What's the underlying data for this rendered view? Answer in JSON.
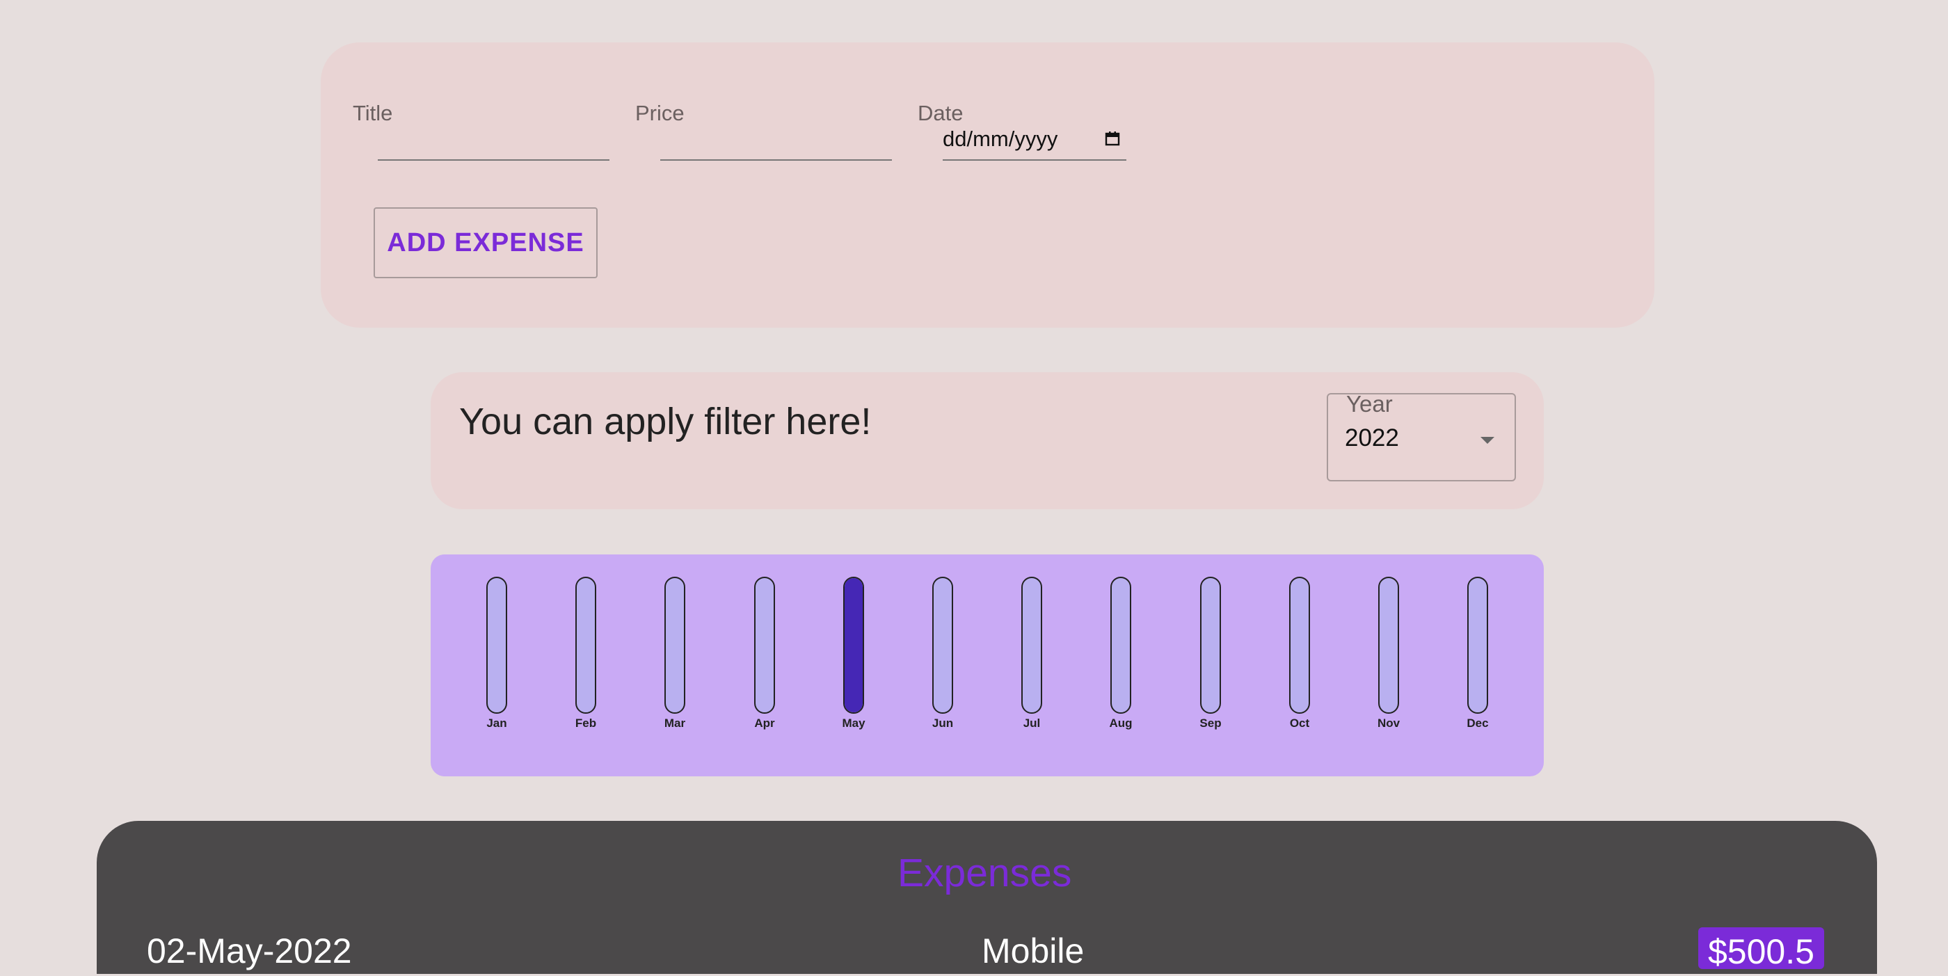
{
  "form": {
    "title_label": "Title",
    "title_value": "",
    "price_label": "Price",
    "price_value": "",
    "date_label": "Date",
    "date_placeholder": "dd/mm/yyyy",
    "add_button_label": "ADD EXPENSE"
  },
  "filter": {
    "heading": "You can apply filter here!",
    "year_label": "Year",
    "year_value": "2022"
  },
  "chart_data": {
    "type": "bar",
    "categories": [
      "Jan",
      "Feb",
      "Mar",
      "Apr",
      "May",
      "Jun",
      "Jul",
      "Aug",
      "Sep",
      "Oct",
      "Nov",
      "Dec"
    ],
    "values": [
      0,
      0,
      0,
      0,
      1,
      0,
      0,
      0,
      0,
      0,
      0,
      0
    ],
    "ylim": [
      0,
      1
    ],
    "fill_color": "#4527b5",
    "track_color": "#b9b0f0"
  },
  "expenses": {
    "title": "Expenses",
    "items": [
      {
        "date": "02-May-2022",
        "title": "Mobile",
        "price": "$500.5"
      }
    ]
  },
  "colors": {
    "background": "#e6dedd",
    "card": "#e9d4d4",
    "accent": "#7b2bd8",
    "chart_bg": "#c9aaf5",
    "expenses_bg": "#4b494a"
  }
}
